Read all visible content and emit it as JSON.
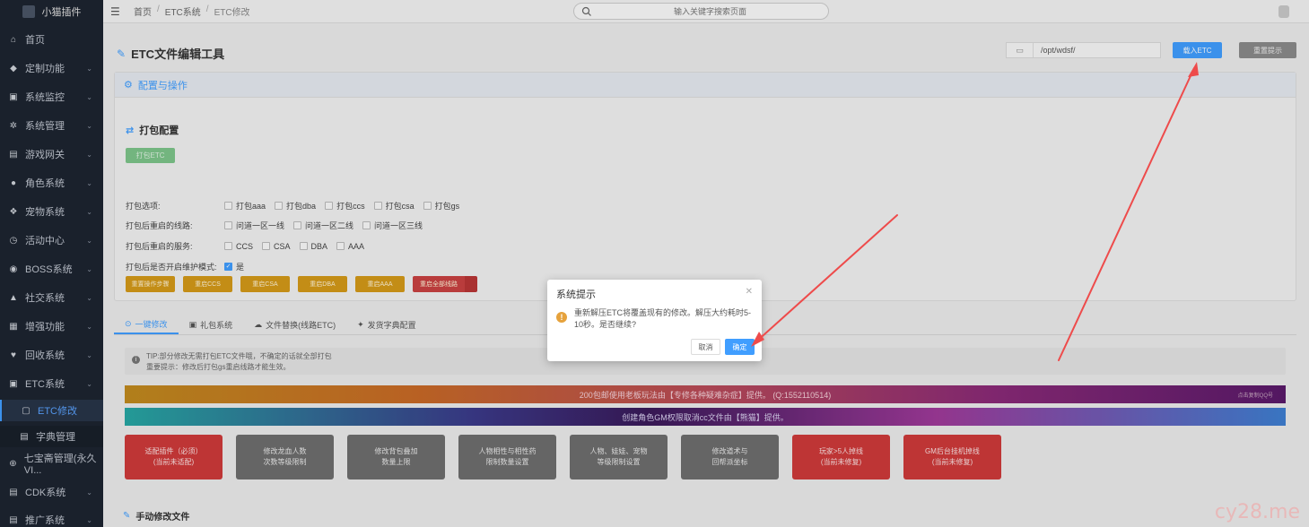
{
  "sidebar": {
    "logo": "小猫插件",
    "items": [
      {
        "icon": "home-icon",
        "glyph": "⌂",
        "label": "首页",
        "chev": false
      },
      {
        "icon": "diamond-icon",
        "glyph": "◆",
        "label": "定制功能",
        "chev": true
      },
      {
        "icon": "monitor-icon",
        "glyph": "▣",
        "label": "系统监控",
        "chev": true
      },
      {
        "icon": "gear-icon",
        "glyph": "✲",
        "label": "系统管理",
        "chev": true
      },
      {
        "icon": "gamepad-icon",
        "glyph": "▤",
        "label": "游戏网关",
        "chev": true
      },
      {
        "icon": "user-icon",
        "glyph": "●",
        "label": "角色系统",
        "chev": true
      },
      {
        "icon": "pet-icon",
        "glyph": "❖",
        "label": "宠物系统",
        "chev": true
      },
      {
        "icon": "clock-icon",
        "glyph": "◷",
        "label": "活动中心",
        "chev": true
      },
      {
        "icon": "boss-icon",
        "glyph": "◉",
        "label": "BOSS系统",
        "chev": true
      },
      {
        "icon": "social-icon",
        "glyph": "▲",
        "label": "社交系统",
        "chev": true
      },
      {
        "icon": "boost-icon",
        "glyph": "▦",
        "label": "增强功能",
        "chev": true
      },
      {
        "icon": "heart-icon",
        "glyph": "♥",
        "label": "回收系统",
        "chev": true
      },
      {
        "icon": "etc-icon",
        "glyph": "▣",
        "label": "ETC系统",
        "chev": true
      },
      {
        "icon": "etc-edit-icon",
        "glyph": "▢",
        "label": "ETC修改",
        "chev": false
      },
      {
        "icon": "dict-icon",
        "glyph": "▤",
        "label": "字典管理",
        "chev": false
      },
      {
        "icon": "treasure-icon",
        "glyph": "⊕",
        "label": "七宝斋管理(永久VI...",
        "chev": false
      },
      {
        "icon": "cdk-icon",
        "glyph": "▤",
        "label": "CDK系统",
        "chev": true
      },
      {
        "icon": "promo-icon",
        "glyph": "▤",
        "label": "推广系统",
        "chev": true
      }
    ]
  },
  "topbar": {
    "breadcrumb": [
      "首页",
      "ETC系统",
      "ETC修改"
    ],
    "search_placeholder": "输入关键字搜索页面"
  },
  "page": {
    "title": "ETC文件编辑工具",
    "path_value": "/opt/wdsf/",
    "load_button": "载入ETC",
    "reset_button": "重置提示"
  },
  "config": {
    "header": "配置与操作",
    "section_title": "打包配置",
    "pack_button": "打包ETC",
    "rows": [
      {
        "label": "打包选项:",
        "options": [
          {
            "text": "打包aaa",
            "checked": false
          },
          {
            "text": "打包dba",
            "checked": false
          },
          {
            "text": "打包ccs",
            "checked": false
          },
          {
            "text": "打包csa",
            "checked": false
          },
          {
            "text": "打包gs",
            "checked": false
          }
        ]
      },
      {
        "label": "打包后重启的线路:",
        "options": [
          {
            "text": "问道一区一线",
            "checked": false
          },
          {
            "text": "问道一区二线",
            "checked": false
          },
          {
            "text": "问道一区三线",
            "checked": false
          }
        ]
      },
      {
        "label": "打包后重启的服务:",
        "options": [
          {
            "text": "CCS",
            "checked": false
          },
          {
            "text": "CSA",
            "checked": false
          },
          {
            "text": "DBA",
            "checked": false
          },
          {
            "text": "AAA",
            "checked": false
          }
        ]
      },
      {
        "label": "打包后是否开启维护模式:",
        "options": [
          {
            "text": "是",
            "checked": true
          }
        ]
      }
    ],
    "action_buttons": [
      "重置操作步骤",
      "重启CCS",
      "重启CSA",
      "重启DBA",
      "重启AAA",
      "重启全部线路"
    ]
  },
  "tabs": [
    {
      "icon": "bolt-icon",
      "label": "一键修改",
      "active": true
    },
    {
      "icon": "gift-icon",
      "label": "礼包系统",
      "active": false
    },
    {
      "icon": "cloud-icon",
      "label": "文件替换(线路ETC)",
      "active": false
    },
    {
      "icon": "pin-icon",
      "label": "发货字典配置",
      "active": false
    }
  ],
  "tip": {
    "line1": "TIP:部分修改无需打包ETC文件哦，不确定的话就全部打包",
    "line2": "重要提示：修改后打包gs重启线路才能生效。"
  },
  "banners": {
    "b1": "200包邮使用老板玩法由【专修各种疑难杂症】提供。 (Q:1552110514)",
    "b1_corner": "点击复制QQ号",
    "b2": "创建角色GM权限取消cc文件由【熊猫】提供。"
  },
  "features": [
    {
      "text": "适配插件（必须）\n(当前未适配)",
      "style": "red"
    },
    {
      "text": "修改龙血人数\n次数等级限制",
      "style": "gray"
    },
    {
      "text": "修改背包叠加\n数量上限",
      "style": "gray"
    },
    {
      "text": "人物相性与相性药\n限制数量设置",
      "style": "gray"
    },
    {
      "text": "人物、娃娃、宠物\n等级限制设置",
      "style": "gray"
    },
    {
      "text": "修改道术与\n回帮派坐标",
      "style": "gray"
    },
    {
      "text": "玩家>5人掉线\n(当前未修复)",
      "style": "red"
    },
    {
      "text": "GM后台挂机掉线\n(当前未修复)",
      "style": "red"
    }
  ],
  "manual_section": "手动修改文件",
  "dialog": {
    "title": "系统提示",
    "message": "重新解压ETC将覆盖现有的修改。解压大约耗时5-10秒。是否继续?",
    "cancel": "取消",
    "ok": "确定"
  },
  "watermark": "cy28.me"
}
